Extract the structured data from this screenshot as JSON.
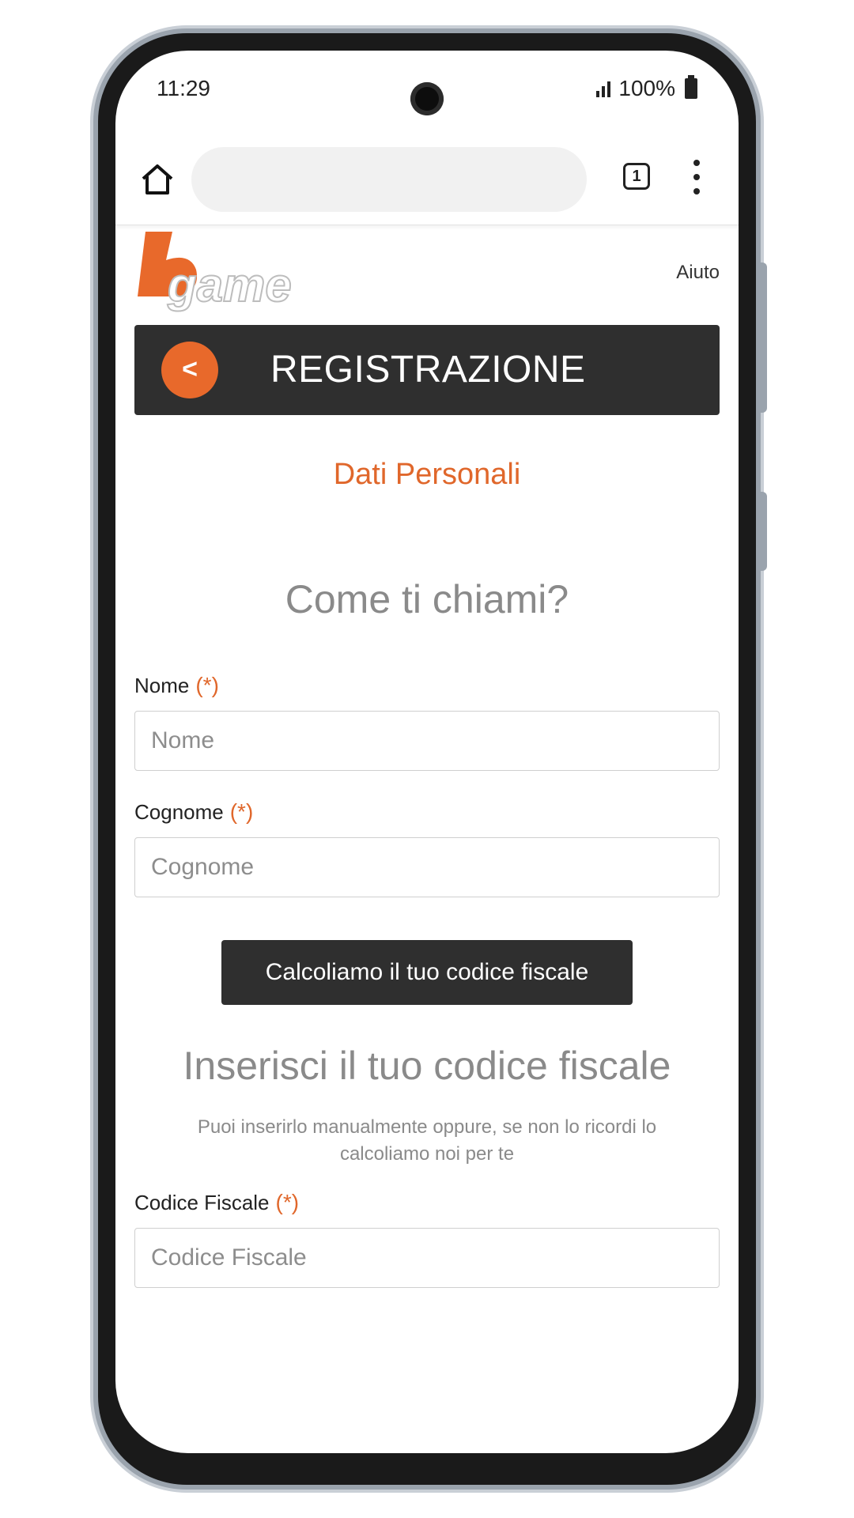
{
  "status_bar": {
    "time": "11:29",
    "battery": "100%"
  },
  "browser": {
    "tab_count": "1"
  },
  "header": {
    "help_link": "Aiuto",
    "back_label": "<",
    "title": "REGISTRAZIONE"
  },
  "form": {
    "section_title": "Dati Personali",
    "question": "Come ti chiami?",
    "nome_label": "Nome",
    "nome_placeholder": "Nome",
    "cognome_label": "Cognome",
    "cognome_placeholder": "Cognome",
    "required_mark": "(*)",
    "calc_button": "Calcoliamo il tuo codice fiscale",
    "cf_title": "Inserisci il tuo codice fiscale",
    "cf_subtitle": "Puoi inserirlo manualmente oppure, se non lo ricordi lo calcoliamo noi per te",
    "cf_label": "Codice Fiscale",
    "cf_placeholder": "Codice Fiscale"
  },
  "colors": {
    "accent": "#e0672b",
    "dark": "#2f2f2f"
  }
}
